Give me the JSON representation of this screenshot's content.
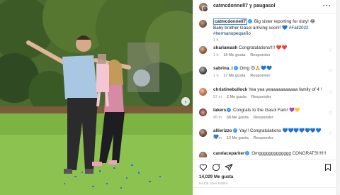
{
  "header": {
    "title": "catmcdonnell7 y paugasol",
    "more": "···"
  },
  "caption": {
    "user": "catmcdonnell7",
    "text": " Big sister reporting for duty! 😂 Baby brother Gasol arriving soon!! 💙 ",
    "hashtags": "#Fall2022 #hermanopequeño",
    "time": "1 h"
  },
  "comments": [
    {
      "user": "shariawash",
      "text": " Congratulations!!!! ❤️❤️",
      "time": "1 h",
      "likes": "10 Me gusta",
      "reply": "Responder"
    },
    {
      "user": "sabrina_i",
      "text": " Omg 😍🙏💙💙",
      "time": "1 h",
      "likes": "17 Me gusta",
      "reply": "Responder"
    },
    {
      "user": "christinebullock",
      "text": " Yea yea yeaaaaaaaaaaa family of 4 !",
      "time": "57 m",
      "likes": "2 Me gusta",
      "reply": "Responder"
    },
    {
      "user": "lakers",
      "text": " Congrats to the Gasol Fam! 💜💛",
      "time": "45 m",
      "likes": "58 Me gusta",
      "reply": "Responder"
    },
    {
      "user": "allierizzo",
      "text": " Yay!! Congratulations 💙💙💙💙💙💙💙💙",
      "time": "53 m",
      "likes": "13 Me gusta",
      "reply": "Responder"
    },
    {
      "user": "candaceparker",
      "text": " Omggggggggggggg CONGRATS!!!!!!! 🙌",
      "time": "",
      "likes": "",
      "reply": ""
    }
  ],
  "footer": {
    "likes": "14,029 Me gusta",
    "when": "HACE UNA HORA"
  },
  "icons": {
    "heart": "heart-icon",
    "comment": "comment-icon",
    "share": "share-icon",
    "bookmark": "bookmark-icon",
    "nav": "chevron-right-icon"
  },
  "colors": {
    "verified": "#3897f0",
    "grass": "#86b848",
    "link": "#00376b"
  }
}
